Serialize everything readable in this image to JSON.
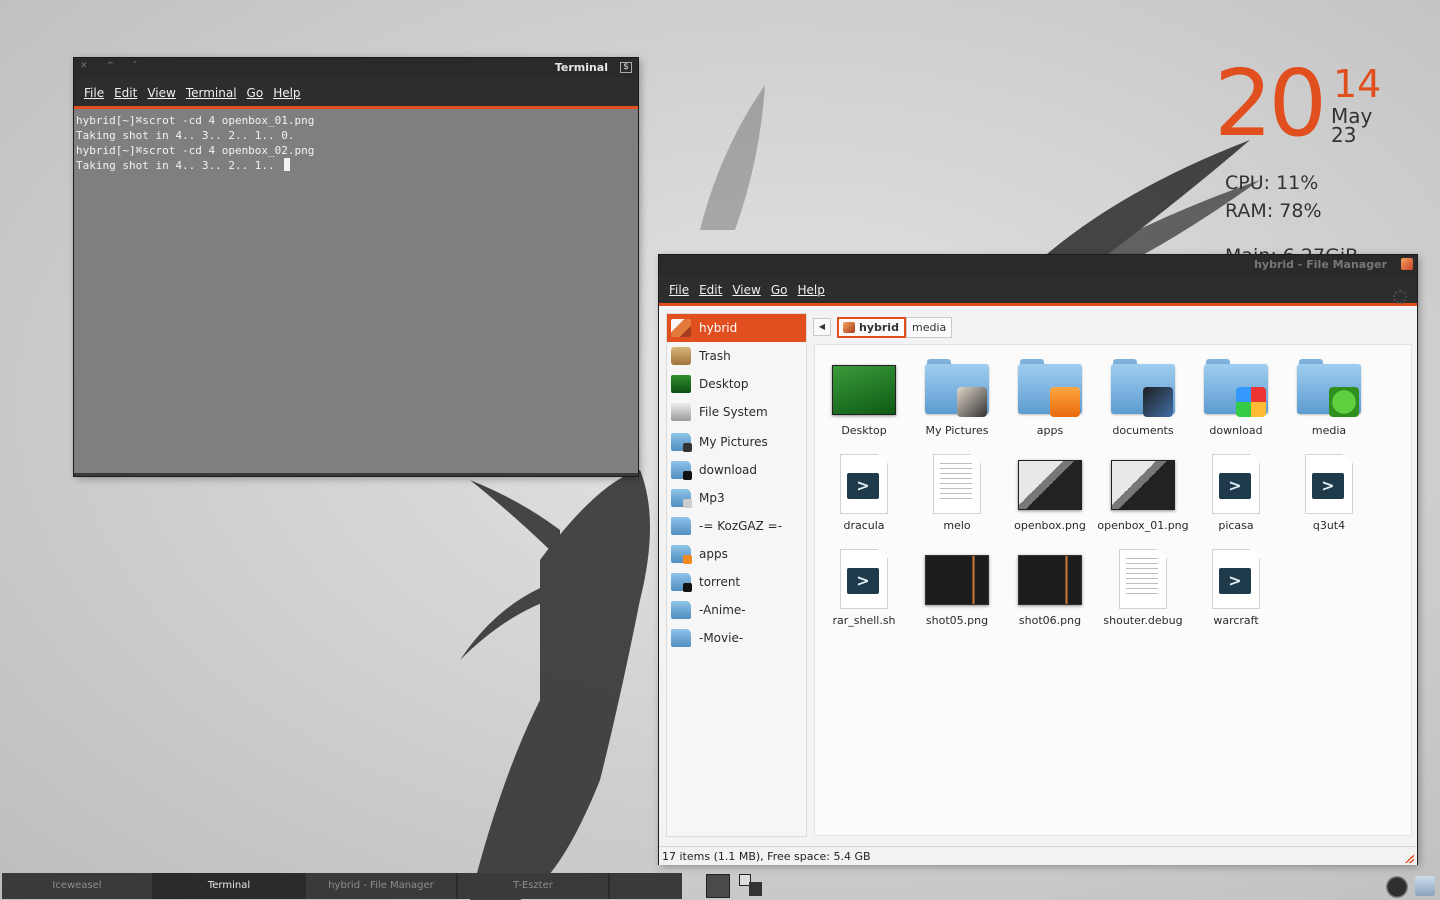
{
  "conky": {
    "day": "20",
    "year": "14",
    "month": "May",
    "date": "23",
    "cpu": "CPU: 11%",
    "ram": "RAM: 78%",
    "main": "Main: 6.27GiB"
  },
  "terminal": {
    "title": "Terminal",
    "menu": [
      "File",
      "Edit",
      "View",
      "Terminal",
      "Go",
      "Help"
    ],
    "lines": [
      "hybrid[~]⌘scrot -cd 4 openbox_01.png",
      "Taking shot in 4.. 3.. 2.. 1.. 0.",
      "hybrid[~]⌘scrot -cd 4 openbox_02.png",
      "Taking shot in 4.. 3.. 2.. 1.. "
    ]
  },
  "filemanager": {
    "title": "hybrid - File Manager",
    "menu": [
      "File",
      "Edit",
      "View",
      "Go",
      "Help"
    ],
    "sidebar": [
      {
        "label": "hybrid",
        "icon": "home-icon",
        "active": true
      },
      {
        "label": "Trash",
        "icon": "trash-icon"
      },
      {
        "label": "Desktop",
        "icon": "desktop-icon"
      },
      {
        "label": "File System",
        "icon": "drive-icon"
      },
      {
        "label": "My Pictures",
        "icon": "folder-icon"
      },
      {
        "label": "download",
        "icon": "folder-icon"
      },
      {
        "label": "Mp3",
        "icon": "folder-icon"
      },
      {
        "label": "-= KozGAZ =-",
        "icon": "folder-icon"
      },
      {
        "label": "apps",
        "icon": "folder-icon"
      },
      {
        "label": "torrent",
        "icon": "folder-icon"
      },
      {
        "label": "-Anime-",
        "icon": "folder-icon"
      },
      {
        "label": "-Movie-",
        "icon": "folder-icon"
      }
    ],
    "path": {
      "current": "hybrid",
      "next": "media"
    },
    "items": [
      {
        "name": "Desktop",
        "kind": "thumb-desk"
      },
      {
        "name": "My Pictures",
        "kind": "folder-pics"
      },
      {
        "name": "apps",
        "kind": "folder-apps"
      },
      {
        "name": "documents",
        "kind": "folder-docs"
      },
      {
        "name": "download",
        "kind": "folder-dl"
      },
      {
        "name": "media",
        "kind": "folder-media"
      },
      {
        "name": "dracula",
        "kind": "script"
      },
      {
        "name": "melo",
        "kind": "text"
      },
      {
        "name": "openbox.png",
        "kind": "thumb-shot"
      },
      {
        "name": "openbox_01.png",
        "kind": "thumb-shot"
      },
      {
        "name": "picasa",
        "kind": "script"
      },
      {
        "name": "q3ut4",
        "kind": "script"
      },
      {
        "name": "rar_shell.sh",
        "kind": "script"
      },
      {
        "name": "shot05.png",
        "kind": "thumb-dark"
      },
      {
        "name": "shot06.png",
        "kind": "thumb-dark"
      },
      {
        "name": "shouter.debug",
        "kind": "text"
      },
      {
        "name": "warcraft",
        "kind": "script"
      }
    ],
    "status": "17 items (1.1 MB), Free space: 5.4 GB"
  },
  "taskbar": {
    "tasks": [
      "Iceweasel",
      "Terminal",
      "hybrid - File Manager",
      "T-Eszter"
    ]
  },
  "colors": {
    "accent": "#e24f1e",
    "titlebar": "#2b2b2b"
  }
}
